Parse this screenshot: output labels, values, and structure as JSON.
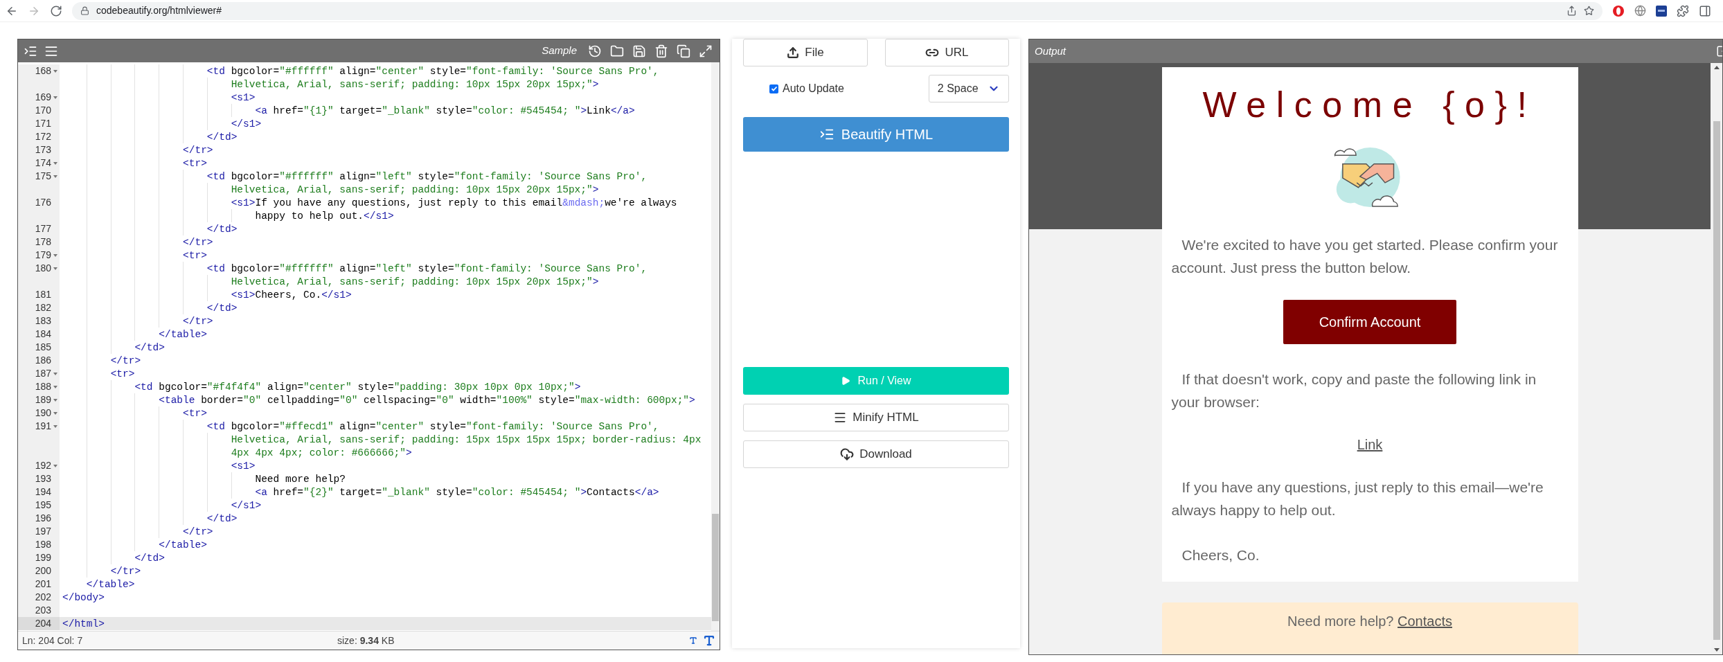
{
  "browser": {
    "url": "codebeautify.org/htmlviewer#"
  },
  "editor": {
    "sample_label": "Sample",
    "lines": [
      {
        "number": "168",
        "foldable": true,
        "current": false,
        "text": "                        <td bgcolor=\"#ffffff\" align=\"center\" style=\"font-family: 'Source Sans Pro',",
        "wraps": [
          "                            Helvetica, Arial, sans-serif; padding: 10px 15px 20px 15px;\">"
        ]
      },
      {
        "number": "169",
        "foldable": true,
        "current": false,
        "text": "                            <s1>"
      },
      {
        "number": "170",
        "foldable": false,
        "current": false,
        "text": "                                <a href=\"{1}\" target=\"_blank\" style=\"color: #545454; \">Link</a>"
      },
      {
        "number": "171",
        "foldable": false,
        "current": false,
        "text": "                            </s1>"
      },
      {
        "number": "172",
        "foldable": false,
        "current": false,
        "text": "                        </td>"
      },
      {
        "number": "173",
        "foldable": false,
        "current": false,
        "text": "                    </tr>"
      },
      {
        "number": "174",
        "foldable": true,
        "current": false,
        "text": "                    <tr>"
      },
      {
        "number": "175",
        "foldable": true,
        "current": false,
        "text": "                        <td bgcolor=\"#ffffff\" align=\"left\" style=\"font-family: 'Source Sans Pro',",
        "wraps": [
          "                            Helvetica, Arial, sans-serif; padding: 10px 15px 20px 15px;\">"
        ]
      },
      {
        "number": "176",
        "foldable": false,
        "current": false,
        "text": "                            <s1>If you have any questions, just reply to this email&mdash;we're always",
        "wraps": [
          "                                happy to help out.</s1>"
        ]
      },
      {
        "number": "177",
        "foldable": false,
        "current": false,
        "text": "                        </td>"
      },
      {
        "number": "178",
        "foldable": false,
        "current": false,
        "text": "                    </tr>"
      },
      {
        "number": "179",
        "foldable": true,
        "current": false,
        "text": "                    <tr>"
      },
      {
        "number": "180",
        "foldable": true,
        "current": false,
        "text": "                        <td bgcolor=\"#ffffff\" align=\"left\" style=\"font-family: 'Source Sans Pro',",
        "wraps": [
          "                            Helvetica, Arial, sans-serif; padding: 10px 15px 20px 15px;\">"
        ]
      },
      {
        "number": "181",
        "foldable": false,
        "current": false,
        "text": "                            <s1>Cheers, Co.</s1>"
      },
      {
        "number": "182",
        "foldable": false,
        "current": false,
        "text": "                        </td>"
      },
      {
        "number": "183",
        "foldable": false,
        "current": false,
        "text": "                    </tr>"
      },
      {
        "number": "184",
        "foldable": false,
        "current": false,
        "text": "                </table>"
      },
      {
        "number": "185",
        "foldable": false,
        "current": false,
        "text": "            </td>"
      },
      {
        "number": "186",
        "foldable": false,
        "current": false,
        "text": "        </tr>"
      },
      {
        "number": "187",
        "foldable": true,
        "current": false,
        "text": "        <tr>"
      },
      {
        "number": "188",
        "foldable": true,
        "current": false,
        "text": "            <td bgcolor=\"#f4f4f4\" align=\"center\" style=\"padding: 30px 10px 0px 10px;\">"
      },
      {
        "number": "189",
        "foldable": true,
        "current": false,
        "text": "                <table border=\"0\" cellpadding=\"0\" cellspacing=\"0\" width=\"100%\" style=\"max-width: 600px;\">"
      },
      {
        "number": "190",
        "foldable": true,
        "current": false,
        "text": "                    <tr>"
      },
      {
        "number": "191",
        "foldable": true,
        "current": false,
        "text": "                        <td bgcolor=\"#ffecd1\" align=\"center\" style=\"font-family: 'Source Sans Pro',",
        "wraps": [
          "                            Helvetica, Arial, sans-serif; padding: 15px 15px 15px 15px; border-radius: 4px",
          "                            4px 4px 4px; color: #666666;\">"
        ]
      },
      {
        "number": "192",
        "foldable": true,
        "current": false,
        "text": "                            <s1>"
      },
      {
        "number": "193",
        "foldable": false,
        "current": false,
        "text": "                                Need more help?"
      },
      {
        "number": "194",
        "foldable": false,
        "current": false,
        "text": "                                <a href=\"{2}\" target=\"_blank\" style=\"color: #545454; \">Contacts</a>"
      },
      {
        "number": "195",
        "foldable": false,
        "current": false,
        "text": "                            </s1>"
      },
      {
        "number": "196",
        "foldable": false,
        "current": false,
        "text": "                        </td>"
      },
      {
        "number": "197",
        "foldable": false,
        "current": false,
        "text": "                    </tr>"
      },
      {
        "number": "198",
        "foldable": false,
        "current": false,
        "text": "                </table>"
      },
      {
        "number": "199",
        "foldable": false,
        "current": false,
        "text": "            </td>"
      },
      {
        "number": "200",
        "foldable": false,
        "current": false,
        "text": "        </tr>"
      },
      {
        "number": "201",
        "foldable": false,
        "current": false,
        "text": "    </table>"
      },
      {
        "number": "202",
        "foldable": false,
        "current": false,
        "text": "</body>"
      },
      {
        "number": "203",
        "foldable": false,
        "current": false
      },
      {
        "number": "204",
        "foldable": false,
        "current": true,
        "text": "</html>"
      }
    ],
    "status": {
      "position": "Ln: 204 Col: 7",
      "size": "size: **9.34** KB"
    }
  },
  "controls": {
    "file": "File",
    "url": "URL",
    "auto_update": {
      "label": "Auto Update",
      "checked": true
    },
    "indent": "2 Space",
    "beautify": "Beautify HTML",
    "run": "Run / View",
    "minify": "Minify HTML",
    "download": "Download"
  },
  "output": {
    "title": "Output",
    "email": {
      "heading": "Welcome {o}!",
      "intro": "We're excited to have you get started. Please confirm your account. Just press the button below.",
      "button": "Confirm Account",
      "fallback": "If that doesn't work, copy and paste the following link in your browser:",
      "link": "Link",
      "questions": "If you have any questions, just reply to this email—we're always happy to help out.",
      "signoff": "Cheers, Co.",
      "help_text": "Need more help?",
      "help_link": "Contacts"
    }
  }
}
